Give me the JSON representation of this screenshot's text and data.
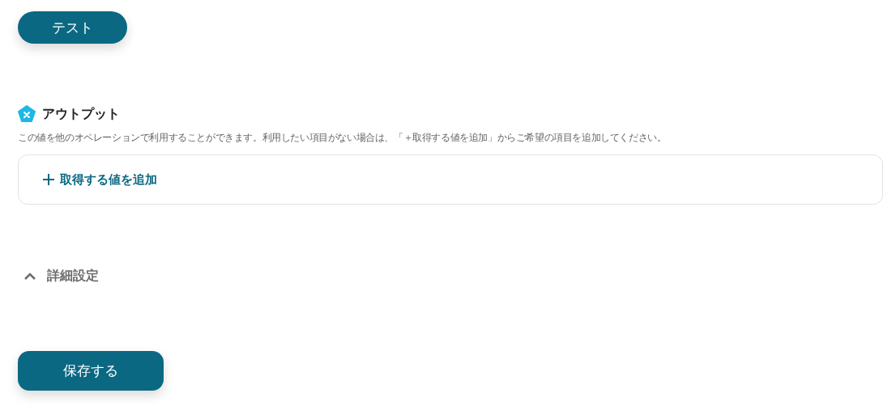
{
  "test_button": {
    "label": "テスト"
  },
  "output": {
    "title": "アウトプット",
    "description": "この値を他のオペレーションで利用することができます。利用したい項目がない場合は、「＋取得する値を追加」からご希望の項目を追加してください。",
    "add_button": {
      "label": "取得する値を追加"
    }
  },
  "advanced_settings": {
    "label": "詳細設定",
    "expanded": false
  },
  "save_button": {
    "label": "保存する"
  }
}
